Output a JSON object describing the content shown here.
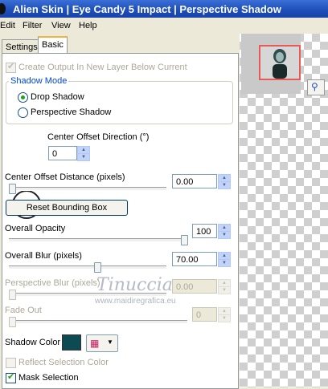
{
  "window": {
    "title": "Alien Skin  |  Eye Candy 5 Impact  |  Perspective Shadow"
  },
  "menu": [
    "Edit",
    "Filter",
    "View",
    "Help"
  ],
  "tabs": [
    "Settings",
    "Basic"
  ],
  "create_output": {
    "label": "Create Output In New Layer Below Current",
    "checked": true
  },
  "shadow_mode": {
    "title": "Shadow Mode",
    "options": [
      "Drop Shadow",
      "Perspective Shadow"
    ],
    "selected": "Drop Shadow"
  },
  "center_offset_direction": {
    "label": "Center Offset Direction (°)",
    "value": "0"
  },
  "center_offset_distance": {
    "label": "Center Offset Distance (pixels)",
    "value": "0.00",
    "slider": 0.0
  },
  "reset_button": "Reset Bounding Box",
  "overall_opacity": {
    "label": "Overall Opacity",
    "value": "100",
    "slider": 1.0
  },
  "overall_blur": {
    "label": "Overall Blur (pixels)",
    "value": "70.00",
    "slider": 0.53
  },
  "perspective_blur": {
    "label": "Perspective Blur (pixels)",
    "value": "0.00",
    "slider": 0.0
  },
  "fade_out": {
    "label": "Fade Out",
    "value": "0",
    "slider": 0.0
  },
  "shadow_color": {
    "label": "Shadow Color",
    "value": "#0d4a52"
  },
  "reflect_selection_color": {
    "label": "Reflect Selection Color",
    "checked": false
  },
  "mask_selection": {
    "label": "Mask Selection",
    "checked": true
  },
  "watermark": {
    "line1": "Tinuccia",
    "line2": "www.maidiregrafica.eu"
  },
  "colors": {
    "accent_check": "#21a121",
    "preview_frame": "#e85a5a"
  }
}
